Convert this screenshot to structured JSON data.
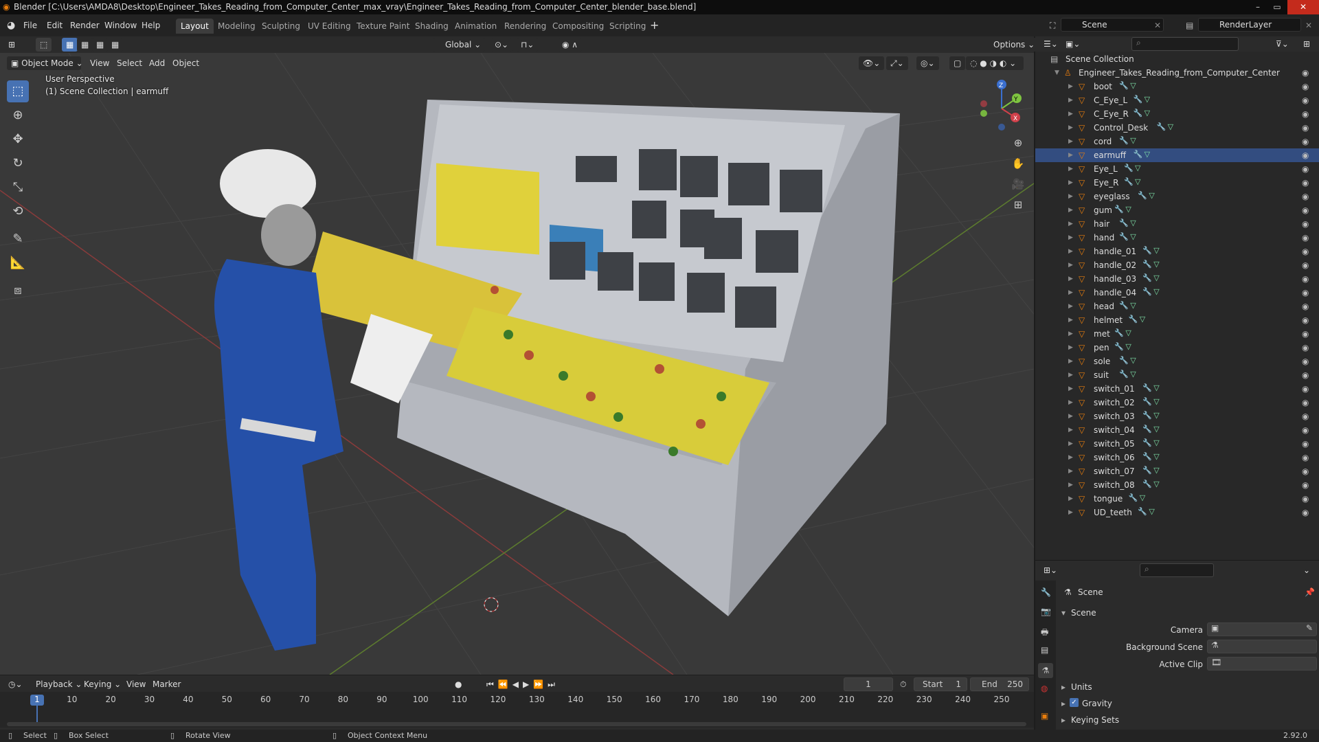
{
  "window": {
    "title": "Blender [C:\\Users\\AMDA8\\Desktop\\Engineer_Takes_Reading_from_Computer_Center_max_vray\\Engineer_Takes_Reading_from_Computer_Center_blender_base.blend]"
  },
  "menu": [
    "File",
    "Edit",
    "Render",
    "Window",
    "Help"
  ],
  "workspaces": [
    "Layout",
    "Modeling",
    "Sculpting",
    "UV Editing",
    "Texture Paint",
    "Shading",
    "Animation",
    "Rendering",
    "Compositing",
    "Scripting"
  ],
  "active_workspace": "Layout",
  "scene_field": "Scene",
  "renderlayer_field": "RenderLayer",
  "toolbar": {
    "orientation": "Global",
    "options": "Options"
  },
  "viewport": {
    "mode": "Object Mode",
    "menus": [
      "View",
      "Select",
      "Add",
      "Object"
    ],
    "overlay_line1": "User Perspective",
    "overlay_line2": "(1) Scene Collection | earmuff",
    "gizmo_labels": {
      "x": "X",
      "y": "Y",
      "z": "Z"
    }
  },
  "outliner": {
    "root": "Scene Collection",
    "collection": "Engineer_Takes_Reading_from_Computer_Center",
    "items": [
      "boot",
      "C_Eye_L",
      "C_Eye_R",
      "Control_Desk",
      "cord",
      "earmuff",
      "Eye_L",
      "Eye_R",
      "eyeglass",
      "gum",
      "hair",
      "hand",
      "handle_01",
      "handle_02",
      "handle_03",
      "handle_04",
      "head",
      "helmet",
      "met",
      "pen",
      "sole",
      "suit",
      "switch_01",
      "switch_02",
      "switch_03",
      "switch_04",
      "switch_05",
      "switch_06",
      "switch_07",
      "switch_08",
      "tongue",
      "UD_teeth"
    ],
    "selected": "earmuff"
  },
  "properties": {
    "context": "Scene",
    "panel": "Scene",
    "camera_label": "Camera",
    "background_label": "Background Scene",
    "clip_label": "Active Clip",
    "units": "Units",
    "gravity": "Gravity",
    "gravity_checked": true,
    "keying_sets": "Keying Sets",
    "version": "2.92.0"
  },
  "timeline": {
    "menus": [
      "Playback",
      "Keying",
      "View",
      "Marker"
    ],
    "current_frame": "1",
    "start_label": "Start",
    "start": "1",
    "end_label": "End",
    "end": "250",
    "ticks": [
      "1",
      "10",
      "20",
      "30",
      "40",
      "50",
      "60",
      "70",
      "80",
      "90",
      "100",
      "110",
      "120",
      "130",
      "140",
      "150",
      "160",
      "170",
      "180",
      "190",
      "200",
      "210",
      "220",
      "230",
      "240",
      "250"
    ]
  },
  "status": {
    "select": "Select",
    "box_select": "Box Select",
    "rotate": "Rotate View",
    "context": "Object Context Menu"
  },
  "colors": {
    "accent": "#4772b3",
    "viewport_bg": "#393939",
    "panel_bg": "#282828",
    "selected_row": "#334d80"
  }
}
